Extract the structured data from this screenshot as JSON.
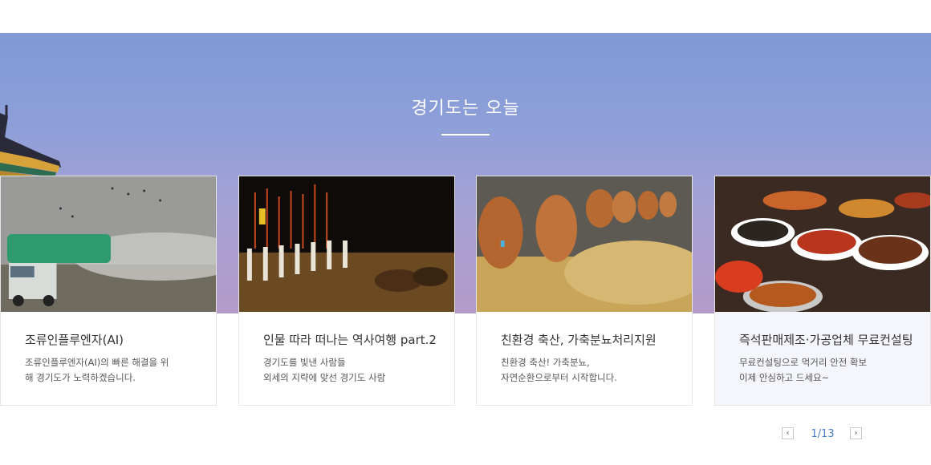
{
  "section": {
    "title": "경기도는 오늘"
  },
  "cards": [
    {
      "title": "조류인플루엔자(AI)",
      "desc": [
        "조류인플루엔자(AI)의 빠른 해결을 위",
        "해 경기도가 노력하겠습니다."
      ]
    },
    {
      "title": "인물 따라 떠나는 역사여행 part.2",
      "desc": [
        "경기도를 빛낸 사람들",
        "외세의 지략에 맞선 경기도 사람"
      ]
    },
    {
      "title": "친환경 축산, 가축분뇨처리지원",
      "desc": [
        "친환경 축산! 가축분뇨,",
        "자연순환으로부터 시작합니다."
      ]
    },
    {
      "title": "즉석판매제조·가공업체 무료컨설팅",
      "desc": [
        "무료컨설팅으로 먹거리 안전 확보",
        "이제 안심하고 드세요~"
      ]
    }
  ],
  "pagination": {
    "current": "1/13",
    "prev": "‹",
    "next": "›"
  },
  "colors": {
    "accent": "#4a7fc9",
    "banner_top": "#7f9ad6",
    "banner_bottom": "#b39bc7"
  }
}
